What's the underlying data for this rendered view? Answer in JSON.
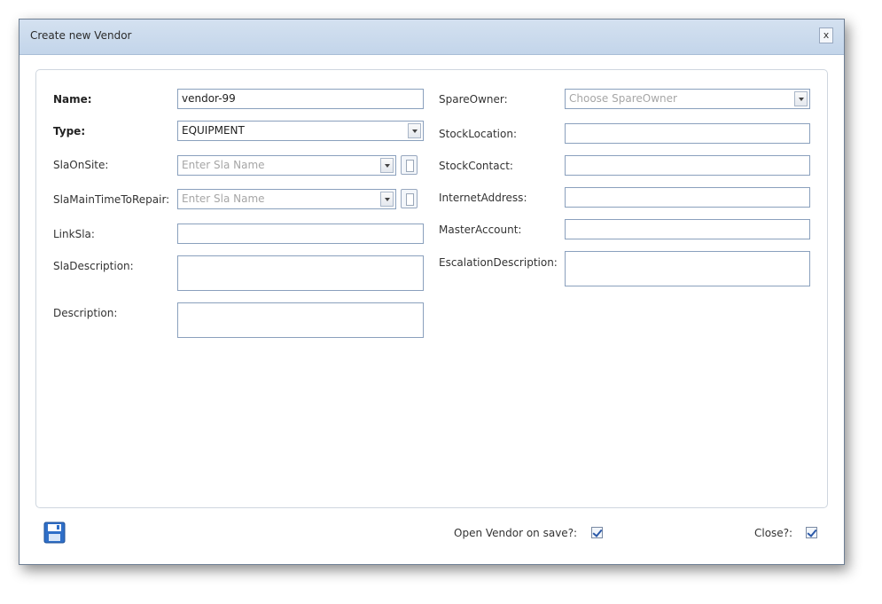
{
  "dialog": {
    "title": "Create new Vendor",
    "close_label": "x"
  },
  "left": {
    "name_label": "Name:",
    "name_value": "vendor-99",
    "type_label": "Type:",
    "type_value": "EQUIPMENT",
    "sla_onsite_label": "SlaOnSite:",
    "sla_onsite_placeholder": "Enter Sla Name",
    "sla_main_label": "SlaMainTimeToRepair:",
    "sla_main_placeholder": "Enter Sla Name",
    "link_sla_label": "LinkSla:",
    "link_sla_value": "",
    "sla_desc_label": "SlaDescription:",
    "sla_desc_value": "",
    "desc_label": "Description:",
    "desc_value": ""
  },
  "right": {
    "spare_owner_label": "SpareOwner:",
    "spare_owner_placeholder": "Choose SpareOwner",
    "stock_location_label": "StockLocation:",
    "stock_location_value": "",
    "stock_contact_label": "StockContact:",
    "stock_contact_value": "",
    "internet_address_label": "InternetAddress:",
    "internet_address_value": "",
    "master_account_label": "MasterAccount:",
    "master_account_value": "",
    "escalation_desc_label": "EscalationDescription:",
    "escalation_desc_value": ""
  },
  "footer": {
    "save_icon": "floppy-disk-icon",
    "open_on_save_label": "Open Vendor on save?:",
    "open_on_save_checked": true,
    "close_label": "Close?:",
    "close_checked": true
  },
  "colors": {
    "titlebar": "#c9daee",
    "field_border": "#8aa0bd",
    "accent": "#2a58a8"
  }
}
